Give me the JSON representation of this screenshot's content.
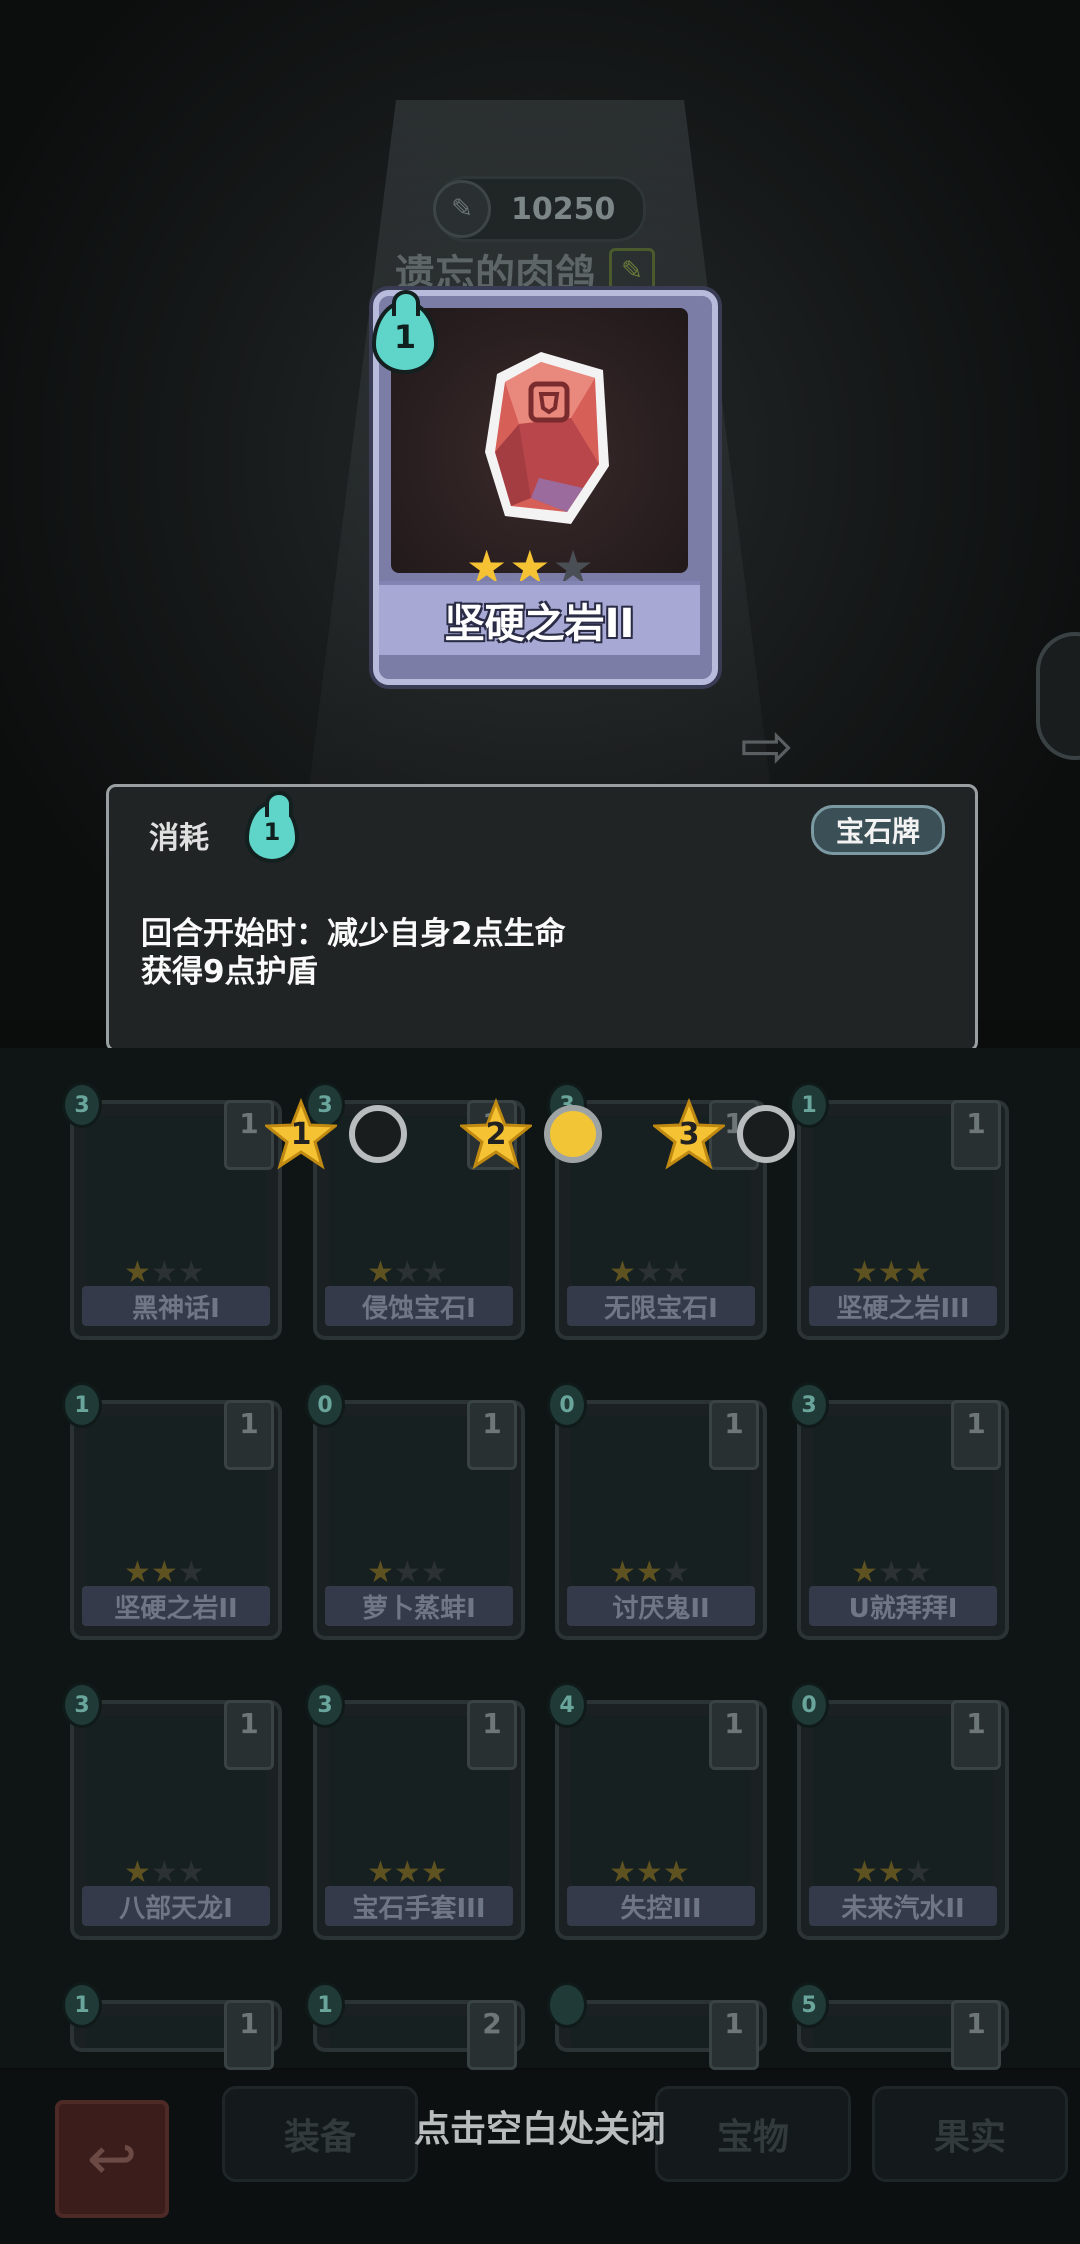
{
  "header": {
    "currency_value": "10250",
    "player_name": "遗忘的肉鸽"
  },
  "featured_card": {
    "cost": "1",
    "name": "坚硬之岩II",
    "stars_filled": 2,
    "stars_total": 3
  },
  "info_panel": {
    "consume_label": "消耗",
    "consume_value": "1",
    "type_tag": "宝石牌",
    "desc_line1": "回合开始时：减少自身2点生命",
    "desc_line2": "获得9点护盾"
  },
  "levels": [
    {
      "label": "1",
      "active": false
    },
    {
      "label": "2",
      "active": true
    },
    {
      "label": "3",
      "active": false
    }
  ],
  "cards": [
    {
      "name": "黑神话I",
      "cost": "3",
      "count": "1",
      "stars": 1
    },
    {
      "name": "侵蚀宝石I",
      "cost": "3",
      "count": "1",
      "stars": 1
    },
    {
      "name": "无限宝石I",
      "cost": "3",
      "count": "1",
      "stars": 1
    },
    {
      "name": "坚硬之岩III",
      "cost": "1",
      "count": "1",
      "stars": 3
    },
    {
      "name": "坚硬之岩II",
      "cost": "1",
      "count": "1",
      "stars": 2
    },
    {
      "name": "萝卜蒸蚌I",
      "cost": "0",
      "count": "1",
      "stars": 1
    },
    {
      "name": "讨厌鬼II",
      "cost": "0",
      "count": "1",
      "stars": 2
    },
    {
      "name": "U就拜拜I",
      "cost": "3",
      "count": "1",
      "stars": 1
    },
    {
      "name": "八部天龙I",
      "cost": "3",
      "count": "1",
      "stars": 1
    },
    {
      "name": "宝石手套III",
      "cost": "3",
      "count": "1",
      "stars": 3
    },
    {
      "name": "失控III",
      "cost": "4",
      "count": "1",
      "stars": 3
    },
    {
      "name": "未来汽水II",
      "cost": "0",
      "count": "1",
      "stars": 2
    },
    {
      "name": "",
      "cost": "1",
      "count": "1",
      "stars": 0
    },
    {
      "name": "",
      "cost": "1",
      "count": "2",
      "stars": 0
    },
    {
      "name": "",
      "cost": "",
      "count": "1",
      "stars": 0
    },
    {
      "name": "",
      "cost": "5",
      "count": "1",
      "stars": 0
    }
  ],
  "bottom": {
    "tab_equip": "装备",
    "tab_treasure": "宝物",
    "tab_fruit": "果实",
    "close_hint": "点击空白处关闭"
  },
  "colors": {
    "star_gold": "#f4c233",
    "cost_teal": "#5fd4c8",
    "card_frame": "#b9bbdc"
  }
}
